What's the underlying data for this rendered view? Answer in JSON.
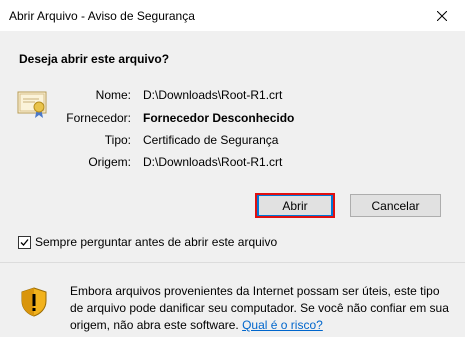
{
  "window": {
    "title": "Abrir Arquivo - Aviso de Segurança",
    "close_label": "✕"
  },
  "dialog": {
    "question": "Deseja abrir este arquivo?",
    "fields": [
      {
        "label": "Nome:",
        "value": "D:\\Downloads\\Root-R1.crt",
        "bold": false
      },
      {
        "label": "Fornecedor:",
        "value": "Fornecedor Desconhecido",
        "bold": true
      },
      {
        "label": "Tipo:",
        "value": "Certificado de Segurança",
        "bold": false
      },
      {
        "label": "Origem:",
        "value": "D:\\Downloads\\Root-R1.crt",
        "bold": false
      }
    ]
  },
  "buttons": {
    "open": "Abrir",
    "cancel": "Cancelar"
  },
  "checkbox": {
    "label": "Sempre perguntar antes de abrir este arquivo",
    "checked": true
  },
  "warning": {
    "text": "Embora arquivos provenientes da Internet possam ser úteis, este tipo de arquivo pode danificar seu computador. Se você não confiar em sua origem, não abra este software. ",
    "link": "Qual é o risco?"
  },
  "colors": {
    "accent": "#0078d7",
    "focus_ring": "#e01010",
    "link": "#0066cc"
  }
}
